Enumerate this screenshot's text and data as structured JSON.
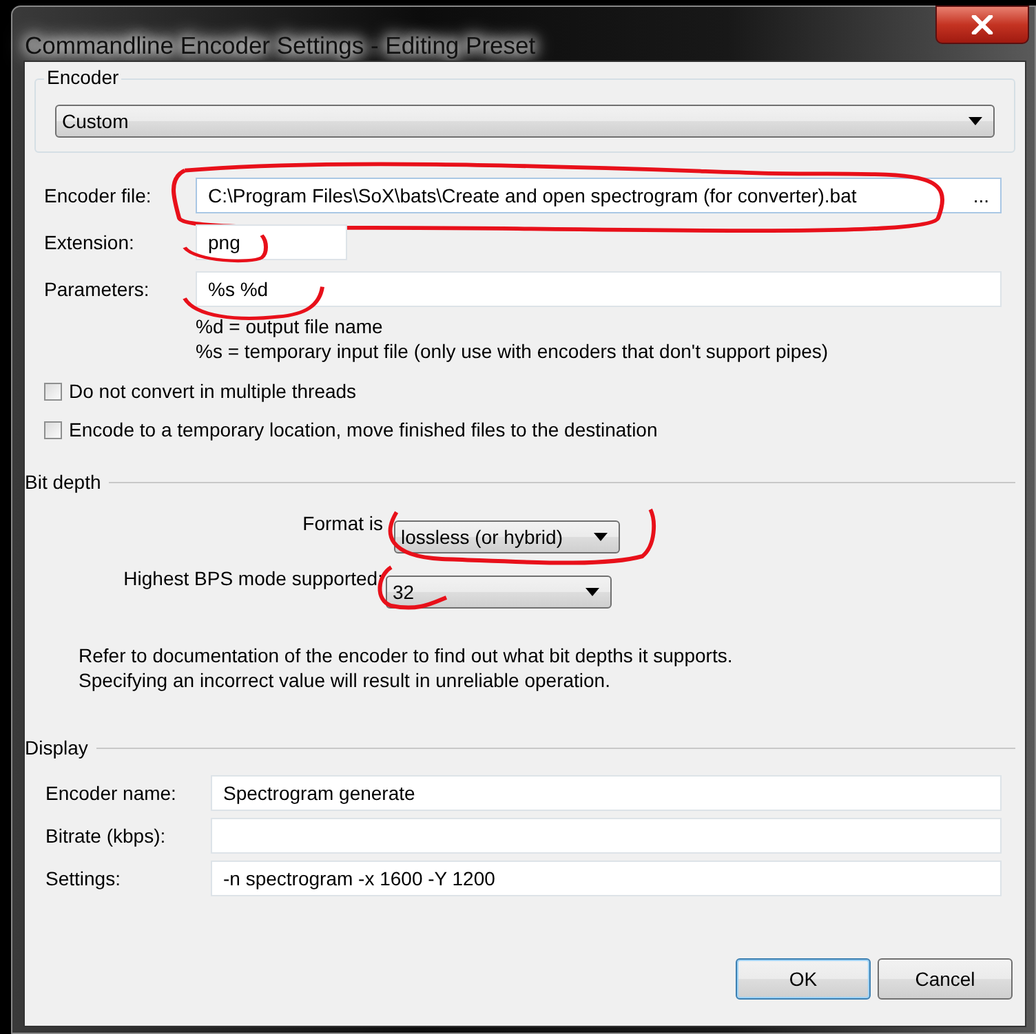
{
  "window": {
    "title": "Commandline Encoder Settings - Editing Preset"
  },
  "encoder_group": {
    "title": "Encoder",
    "dropdown": {
      "value": "Custom"
    }
  },
  "fields": [
    {
      "label": "Encoder file:",
      "value": "C:\\Program Files\\SoX\\bats\\Create and open spectrogram (for converter).bat",
      "kind": "browse",
      "browse_button": "...",
      "annotated": true
    },
    {
      "label": "Extension:",
      "value": "png",
      "kind": "short",
      "annotated": true
    },
    {
      "label": "Parameters:",
      "value": "%s %d",
      "kind": "wide",
      "annotated": true
    }
  ],
  "parameter_hints": [
    "%d = output file name",
    "%s = temporary input file (only use with encoders that don't support pipes)"
  ],
  "checkboxes": [
    {
      "label": "Do not convert in multiple threads",
      "checked": false
    },
    {
      "label": "Encode to a temporary location, move finished files to the destination",
      "checked": false
    }
  ],
  "bit_depth": {
    "title": "Bit depth",
    "dropdowns": [
      {
        "label": "Format is",
        "value": "lossless (or hybrid)",
        "annotated": true
      },
      {
        "label": "Highest BPS mode supported:",
        "value": "32",
        "annotated": true
      }
    ],
    "notes": [
      "Refer to documentation of the encoder to find out what bit depths it supports.",
      "Specifying an incorrect value will result in unreliable operation."
    ]
  },
  "display": {
    "title": "Display",
    "fields": [
      {
        "label": "Encoder name:",
        "value": "Spectrogram generate"
      },
      {
        "label": "Bitrate (kbps):"
      },
      {
        "label": "Settings:",
        "value": "-n spectrogram -x 1600 -Y 1200"
      }
    ]
  },
  "buttons": [
    {
      "label": "OK",
      "default": true
    },
    {
      "label": "Cancel",
      "default": false
    }
  ]
}
